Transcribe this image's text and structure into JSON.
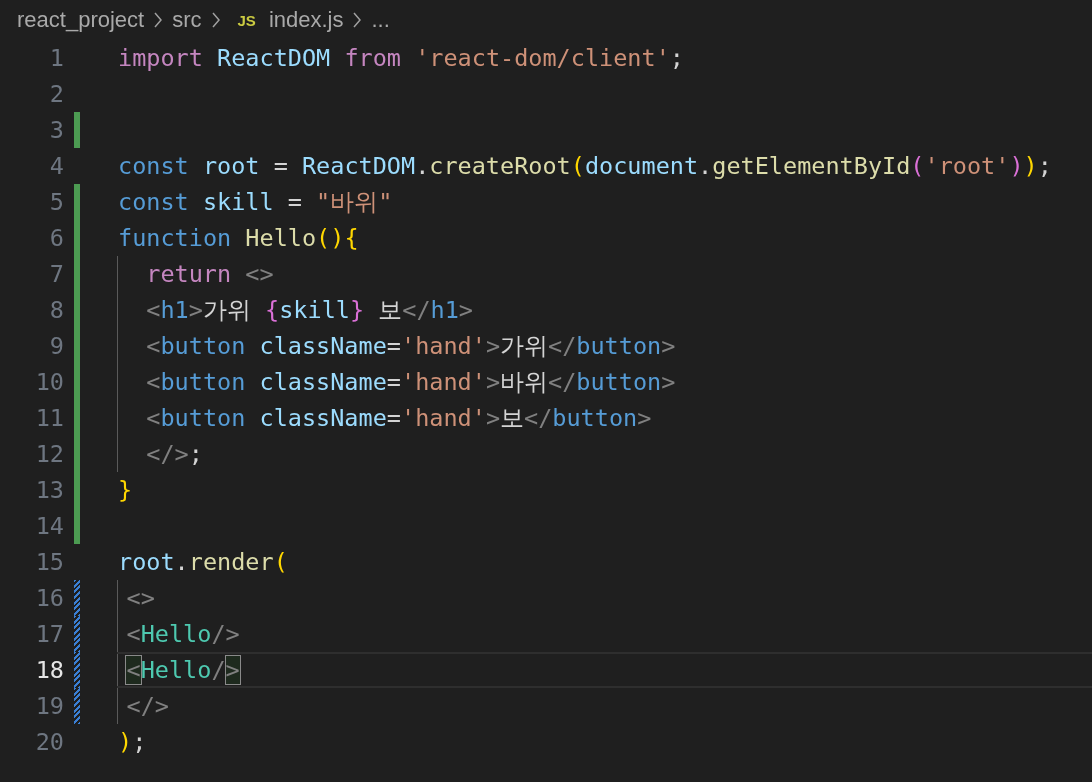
{
  "breadcrumbs": [
    {
      "kind": "folder",
      "label": "react_project"
    },
    {
      "kind": "folder",
      "label": "src"
    },
    {
      "kind": "file",
      "badge": "JS",
      "label": "index.js"
    },
    {
      "kind": "more",
      "label": "..."
    }
  ],
  "lines": [
    {
      "number": "1",
      "active": false,
      "guide": false,
      "tokens": [
        {
          "text": "import ",
          "kind": "keyword"
        },
        {
          "text": "ReactDOM ",
          "kind": "variable"
        },
        {
          "text": "from ",
          "kind": "keyword"
        },
        {
          "text": "'react-dom/client'",
          "kind": "string"
        },
        {
          "text": ";",
          "kind": "plain"
        }
      ]
    },
    {
      "number": "2",
      "active": false
    },
    {
      "number": "3",
      "added": true,
      "active": false
    },
    {
      "number": "4",
      "active": false,
      "guide": false,
      "tokens": [
        {
          "text": "const ",
          "kind": "storage"
        },
        {
          "text": "root",
          "kind": "variable"
        },
        {
          "text": " = ",
          "kind": "plain"
        },
        {
          "text": "ReactDOM",
          "kind": "variable"
        },
        {
          "text": ".",
          "kind": "plain"
        },
        {
          "text": "createRoot",
          "kind": "function"
        },
        {
          "text": "(",
          "kind": "bracket1"
        },
        {
          "text": "document",
          "kind": "variable"
        },
        {
          "text": ".",
          "kind": "plain"
        },
        {
          "text": "getElementById",
          "kind": "function"
        },
        {
          "text": "(",
          "kind": "bracket2"
        },
        {
          "text": "'root'",
          "kind": "string"
        },
        {
          "text": ")",
          "kind": "bracket2"
        },
        {
          "text": ")",
          "kind": "bracket1"
        },
        {
          "text": ";",
          "kind": "plain"
        }
      ]
    },
    {
      "number": "5",
      "added": true,
      "active": false,
      "guide": false,
      "tokens": [
        {
          "text": "const ",
          "kind": "storage"
        },
        {
          "text": "skill",
          "kind": "variable"
        },
        {
          "text": " = ",
          "kind": "plain"
        },
        {
          "text": "\"바위\"",
          "kind": "string"
        }
      ]
    },
    {
      "number": "6",
      "added": true,
      "active": false,
      "guide": false,
      "tokens": [
        {
          "text": "function ",
          "kind": "storage"
        },
        {
          "text": "Hello",
          "kind": "function"
        },
        {
          "text": "(){",
          "kind": "bracket1"
        }
      ]
    },
    {
      "number": "7",
      "added": true,
      "active": false,
      "guide": true,
      "wide_indent": true,
      "tokens": [
        {
          "text": "return ",
          "kind": "keyword"
        },
        {
          "text": "<>",
          "kind": "tagpunct"
        }
      ]
    },
    {
      "number": "8",
      "added": true,
      "active": false,
      "guide": true,
      "wide_indent": true,
      "tokens": [
        {
          "text": "<",
          "kind": "tagpunct"
        },
        {
          "text": "h1",
          "kind": "tag"
        },
        {
          "text": ">",
          "kind": "tagpunct"
        },
        {
          "text": "가위 ",
          "kind": "plain"
        },
        {
          "text": "{",
          "kind": "bracket2"
        },
        {
          "text": "skill",
          "kind": "variable"
        },
        {
          "text": "}",
          "kind": "bracket2"
        },
        {
          "text": " 보",
          "kind": "plain"
        },
        {
          "text": "</",
          "kind": "tagpunct"
        },
        {
          "text": "h1",
          "kind": "tag"
        },
        {
          "text": ">",
          "kind": "tagpunct"
        }
      ]
    },
    {
      "number": "9",
      "added": true,
      "active": false,
      "guide": true,
      "wide_indent": true,
      "tokens": [
        {
          "text": "<",
          "kind": "tagpunct"
        },
        {
          "text": "button ",
          "kind": "tag"
        },
        {
          "text": "className",
          "kind": "attr"
        },
        {
          "text": "=",
          "kind": "plain"
        },
        {
          "text": "'hand'",
          "kind": "string"
        },
        {
          "text": ">",
          "kind": "tagpunct"
        },
        {
          "text": "가위",
          "kind": "plain"
        },
        {
          "text": "</",
          "kind": "tagpunct"
        },
        {
          "text": "button",
          "kind": "tag"
        },
        {
          "text": ">",
          "kind": "tagpunct"
        }
      ]
    },
    {
      "number": "10",
      "added": true,
      "active": false,
      "guide": true,
      "wide_indent": true,
      "tokens": [
        {
          "text": "<",
          "kind": "tagpunct"
        },
        {
          "text": "button ",
          "kind": "tag"
        },
        {
          "text": "className",
          "kind": "attr"
        },
        {
          "text": "=",
          "kind": "plain"
        },
        {
          "text": "'hand'",
          "kind": "string"
        },
        {
          "text": ">",
          "kind": "tagpunct"
        },
        {
          "text": "바위",
          "kind": "plain"
        },
        {
          "text": "</",
          "kind": "tagpunct"
        },
        {
          "text": "button",
          "kind": "tag"
        },
        {
          "text": ">",
          "kind": "tagpunct"
        }
      ]
    },
    {
      "number": "11",
      "added": true,
      "active": false,
      "guide": true,
      "wide_indent": true,
      "tokens": [
        {
          "text": "<",
          "kind": "tagpunct"
        },
        {
          "text": "button ",
          "kind": "tag"
        },
        {
          "text": "className",
          "kind": "attr"
        },
        {
          "text": "=",
          "kind": "plain"
        },
        {
          "text": "'hand'",
          "kind": "string"
        },
        {
          "text": ">",
          "kind": "tagpunct"
        },
        {
          "text": "보",
          "kind": "plain"
        },
        {
          "text": "</",
          "kind": "tagpunct"
        },
        {
          "text": "button",
          "kind": "tag"
        },
        {
          "text": ">",
          "kind": "tagpunct"
        }
      ]
    },
    {
      "number": "12",
      "added": true,
      "active": false,
      "guide": true,
      "wide_indent": true,
      "tokens": [
        {
          "text": "</>",
          "kind": "tagpunct"
        },
        {
          "text": ";",
          "kind": "plain"
        }
      ]
    },
    {
      "number": "13",
      "added": true,
      "active": false,
      "guide": false,
      "tokens": [
        {
          "text": "}",
          "kind": "bracket1"
        }
      ]
    },
    {
      "number": "14",
      "added": true,
      "active": false
    },
    {
      "number": "15",
      "active": false,
      "guide": false,
      "tokens": [
        {
          "text": "root",
          "kind": "variable"
        },
        {
          "text": ".",
          "kind": "plain"
        },
        {
          "text": "render",
          "kind": "function"
        },
        {
          "text": "(",
          "kind": "bracket1"
        }
      ]
    },
    {
      "number": "16",
      "modified": true,
      "active": false,
      "guide": true,
      "wide_indent": false,
      "tokens": [
        {
          "text": "<>",
          "kind": "tagpunct"
        }
      ]
    },
    {
      "number": "17",
      "modified": true,
      "active": false,
      "guide": true,
      "wide_indent": false,
      "tokens": [
        {
          "text": "<",
          "kind": "tagpunct"
        },
        {
          "text": "Hello",
          "kind": "component"
        },
        {
          "text": "/>",
          "kind": "tagpunct"
        }
      ]
    },
    {
      "number": "18",
      "modified": true,
      "active": true,
      "guide": true,
      "wide_indent": false,
      "tokens": [
        {
          "text": "<",
          "kind": "tagpunct",
          "matched": true
        },
        {
          "text": "Hello",
          "kind": "component"
        },
        {
          "text": "/",
          "kind": "tagpunct"
        },
        {
          "text": ">",
          "kind": "tagpunct",
          "matched": true
        }
      ]
    },
    {
      "number": "19",
      "modified": true,
      "active": false,
      "guide": true,
      "wide_indent": false,
      "tokens": [
        {
          "text": "</>",
          "kind": "tagpunct"
        }
      ]
    },
    {
      "number": "20",
      "active": false,
      "guide": false,
      "tokens": [
        {
          "text": ")",
          "kind": "bracket1"
        },
        {
          "text": ";",
          "kind": "plain"
        }
      ]
    }
  ]
}
